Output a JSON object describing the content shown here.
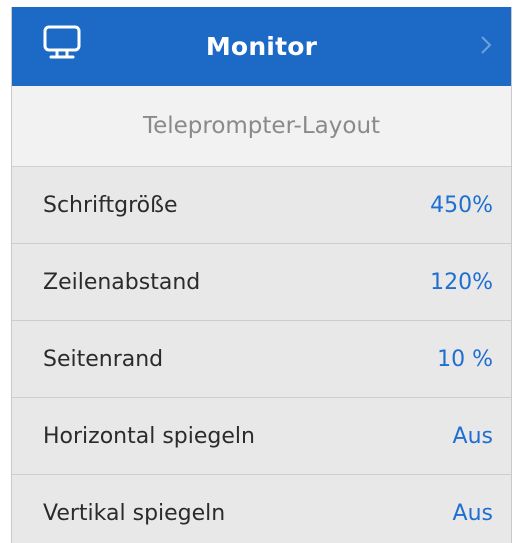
{
  "header": {
    "title": "Monitor",
    "icon": "monitor-icon",
    "accent_color": "#1d6ac6"
  },
  "section": {
    "title": "Teleprompter-Layout"
  },
  "settings": [
    {
      "label": "Schriftgröße",
      "value": "450%"
    },
    {
      "label": "Zeilenabstand",
      "value": "120%"
    },
    {
      "label": "Seitenrand",
      "value": "10 %"
    },
    {
      "label": "Horizontal spiegeln",
      "value": "Aus"
    },
    {
      "label": "Vertikal spiegeln",
      "value": "Aus"
    }
  ],
  "value_color": "#1e6fd0"
}
